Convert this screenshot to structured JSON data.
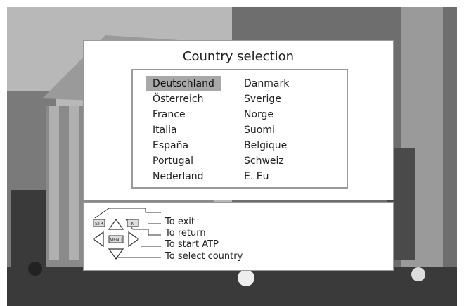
{
  "panel": {
    "title": "Country selection"
  },
  "countries": {
    "left": [
      "Deutschland",
      "Österreich",
      "France",
      "Italia",
      "España",
      "Portugal",
      "Nederland"
    ],
    "right": [
      "Danmark",
      "Sverige",
      "Norge",
      "Suomi",
      "Belgique",
      "Schweiz",
      "E. Eu"
    ],
    "selected": "Deutschland"
  },
  "help": {
    "exit": "To exit",
    "return": "To return",
    "start_atp": "To start ATP",
    "select_country": "To select country",
    "key_str": "STR",
    "key_n": "N",
    "key_menu": "MENU"
  },
  "colors": {
    "selection": "#a8a8a8",
    "border": "#9a9a9a"
  }
}
